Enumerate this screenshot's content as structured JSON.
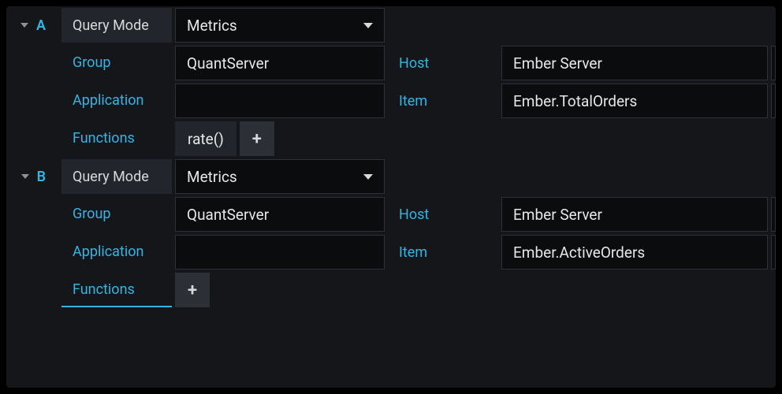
{
  "labels": {
    "query_mode": "Query Mode",
    "group": "Group",
    "host": "Host",
    "application": "Application",
    "item": "Item",
    "functions": "Functions"
  },
  "queries": [
    {
      "letter": "A",
      "mode": "Metrics",
      "group": "QuantServer",
      "host": "Ember Server",
      "application": "",
      "item": "Ember.TotalOrders",
      "functions": [
        "rate()"
      ]
    },
    {
      "letter": "B",
      "mode": "Metrics",
      "group": "QuantServer",
      "host": "Ember Server",
      "application": "",
      "item": "Ember.ActiveOrders",
      "functions": []
    }
  ],
  "icons": {
    "plus": "+"
  }
}
